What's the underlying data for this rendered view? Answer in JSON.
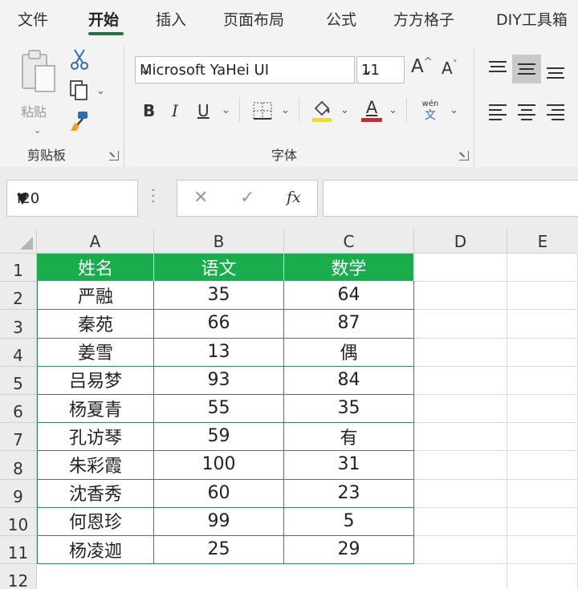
{
  "ribbon_tabs": [
    "文件",
    "开始",
    "插入",
    "页面布局",
    "公式",
    "方方格子",
    "DIY工具箱"
  ],
  "active_tab": "开始",
  "clipboard": {
    "paste_label": "粘贴",
    "group_label": "剪贴板"
  },
  "font": {
    "name": "Microsoft YaHei UI",
    "size": "11",
    "group_label": "字体",
    "grow_label": "A",
    "shrink_label": "A",
    "bold_label": "B",
    "italic_label": "I",
    "underline_label": "U",
    "font_color_letter": "A",
    "phonetic_top": "wén",
    "phonetic_bottom": "文",
    "highlight_color": "#f5e100",
    "font_color": "#e0202a"
  },
  "formula_bar": {
    "name_box": "I20",
    "cancel_glyph": "✕",
    "enter_glyph": "✓",
    "fx_label": "fx",
    "formula": ""
  },
  "columns": [
    "A",
    "B",
    "C",
    "D",
    "E"
  ],
  "row_numbers": [
    "1",
    "2",
    "3",
    "4",
    "5",
    "6",
    "7",
    "8",
    "9",
    "10",
    "11",
    "12"
  ],
  "table": {
    "header": [
      "姓名",
      "语文",
      "数学"
    ],
    "rows": [
      [
        "严融",
        "35",
        "64"
      ],
      [
        "秦苑",
        "66",
        "87"
      ],
      [
        "姜雪",
        "13",
        "偶"
      ],
      [
        "吕易梦",
        "93",
        "84"
      ],
      [
        "杨夏青",
        "55",
        "35"
      ],
      [
        "孔访琴",
        "59",
        "有"
      ],
      [
        "朱彩霞",
        "100",
        "31"
      ],
      [
        "沈香秀",
        "60",
        "23"
      ],
      [
        "何恩珍",
        "99",
        "5"
      ],
      [
        "杨凌迦",
        "25",
        "29"
      ]
    ],
    "header_color": "#1aad4e",
    "border_color": "#2e8b57"
  }
}
